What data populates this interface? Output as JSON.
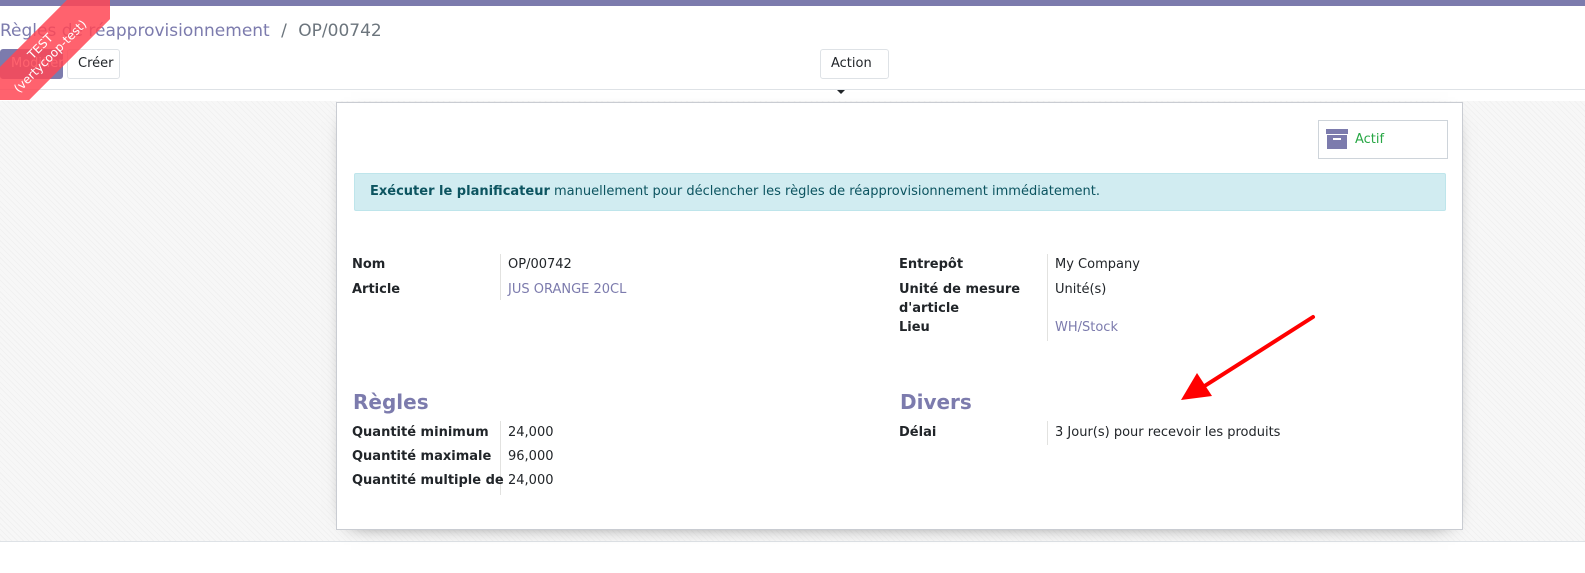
{
  "ribbon": {
    "line1": "TEST",
    "line2": "(vertycoop-test)"
  },
  "breadcrumb": {
    "parent": "Règles de réapprovisionnement",
    "separator": "/",
    "current": "OP/00742"
  },
  "toolbar": {
    "edit_label": "Modifier",
    "create_label": "Créer",
    "action_label": "Action"
  },
  "button_box": {
    "active_label": "Actif",
    "icon": "archive-icon"
  },
  "alert": {
    "bold": "Exécuter le planificateur",
    "rest": " manuellement pour déclencher les règles de réapprovisionnement immédiatement."
  },
  "fields": {
    "name": {
      "label": "Nom",
      "value": "OP/00742"
    },
    "product": {
      "label": "Article",
      "value": "JUS ORANGE 20CL"
    },
    "warehouse": {
      "label": "Entrepôt",
      "value": "My Company"
    },
    "uom": {
      "label_line1": "Unité de mesure",
      "label_line2": "d'article",
      "value": "Unité(s)"
    },
    "location": {
      "label": "Lieu",
      "value": "WH/Stock"
    }
  },
  "rules": {
    "title": "Règles",
    "min": {
      "label": "Quantité minimum",
      "value": "24,000"
    },
    "max": {
      "label": "Quantité maximale",
      "value": "96,000"
    },
    "multiple": {
      "label": "Quantité multiple de",
      "value": "24,000"
    }
  },
  "misc": {
    "title": "Divers",
    "lead": {
      "label": "Délai",
      "days": "3",
      "suffix": "Jour(s) pour recevoir les produits"
    }
  },
  "colors": {
    "brand": "#7c7bad",
    "active": "#28a745",
    "alert_bg": "#d1ecf1",
    "annotation_arrow": "#ff0000"
  }
}
